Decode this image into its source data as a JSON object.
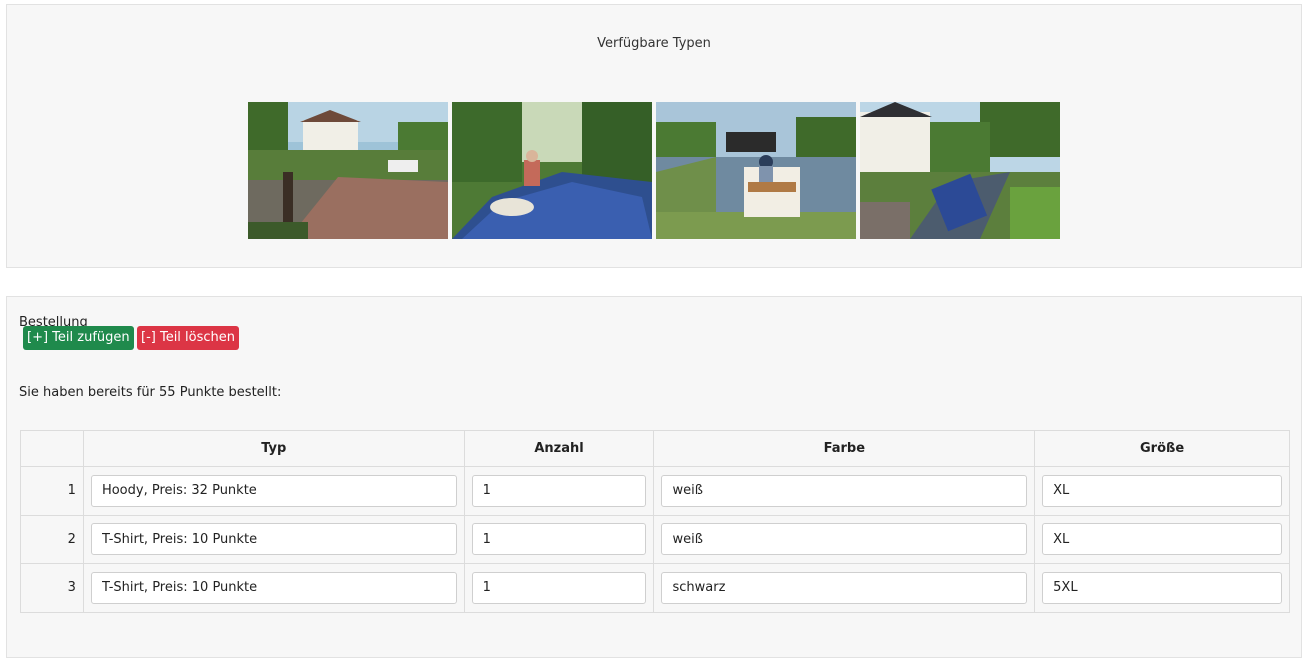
{
  "types_panel": {
    "title": "Verfügbare Typen",
    "photos": [
      {
        "icon": "canal-lock-cottage-photo"
      },
      {
        "icon": "narrowboat-bow-photo"
      },
      {
        "icon": "boat-on-canal-photo"
      },
      {
        "icon": "canal-cottage-boat-photo"
      }
    ]
  },
  "order_panel": {
    "title": "Bestellung",
    "summary": "Sie haben bereits  für 55 Punkte bestellt:",
    "table": {
      "headers": [
        "",
        "Typ",
        "Anzahl",
        "Farbe",
        "Größe"
      ],
      "rows": [
        {
          "num": "1",
          "typ": "Hoody, Preis: 32 Punkte",
          "anzahl": "1",
          "farbe": "weiß",
          "groesse": "XL"
        },
        {
          "num": "2",
          "typ": "T-Shirt, Preis: 10 Punkte",
          "anzahl": "1",
          "farbe": "weiß",
          "groesse": "XL"
        },
        {
          "num": "3",
          "typ": "T-Shirt, Preis: 10 Punkte",
          "anzahl": "1",
          "farbe": "schwarz",
          "groesse": "5XL"
        }
      ]
    },
    "add_label": "[+] Teil zufügen",
    "delete_label": "[-] Teil löschen"
  },
  "colors": {
    "add_button": "#1f8a4c",
    "delete_button": "#dc3545",
    "panel_bg": "#f7f7f7"
  }
}
